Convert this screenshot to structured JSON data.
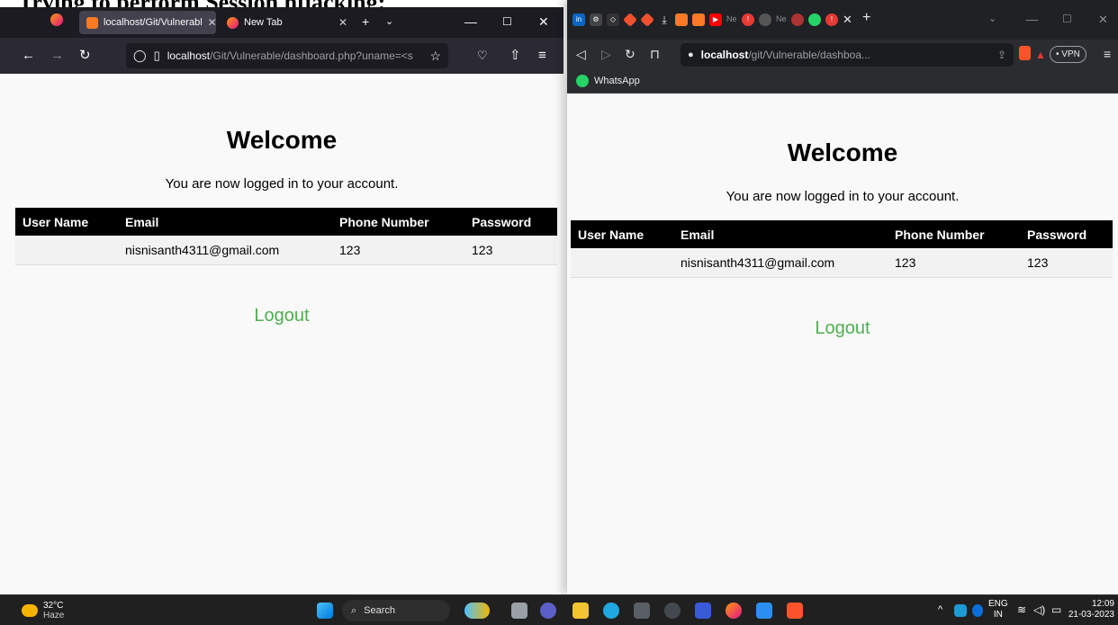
{
  "caption": "Trying to perform Session hijacking:",
  "left_browser": {
    "tabs": [
      {
        "title": "localhost/Git/Vulnerabl",
        "active": true
      },
      {
        "title": "New Tab",
        "active": false
      }
    ],
    "url_host": "localhost",
    "url_path": "/Git/Vulnerable/dashboard.php?uname=<s",
    "window_controls": {
      "minimize": "—",
      "maximize": "☐",
      "close": "✕"
    }
  },
  "right_browser": {
    "url_host": "localhost",
    "url_path": "/git/Vulnerable/dashboa...",
    "vpn_label": "VPN",
    "bookmark": "WhatsApp",
    "tab_labels": [
      "Ne",
      "Ne"
    ]
  },
  "page": {
    "heading": "Welcome",
    "subtext": "You are now logged in to your account.",
    "table": {
      "headers": [
        "User Name",
        "Email",
        "Phone Number",
        "Password"
      ],
      "rows": [
        {
          "user_name": "",
          "email": "nisnisanth4311@gmail.com",
          "phone": "123",
          "password": "123"
        }
      ]
    },
    "logout": "Logout"
  },
  "taskbar": {
    "temperature": "32°C",
    "condition": "Haze",
    "search": "Search",
    "language": "ENG",
    "region": "IN",
    "time": "12:09",
    "date": "21-03-2023"
  },
  "colors": {
    "logout": "#4caf50",
    "table_header": "#000000"
  }
}
